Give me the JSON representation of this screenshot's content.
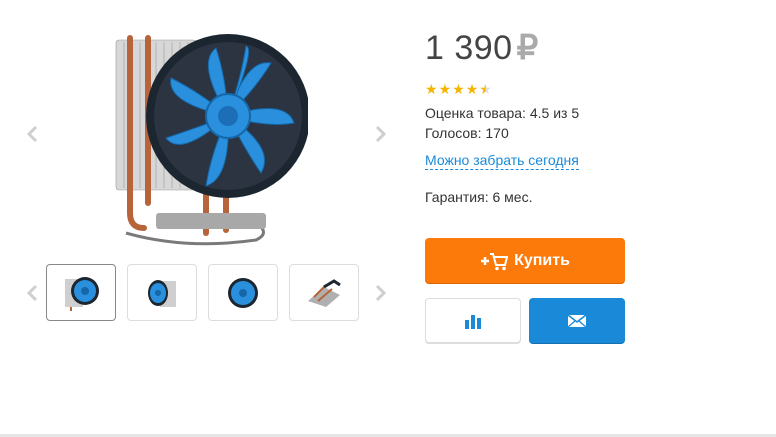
{
  "product": {
    "price": "1 390",
    "currency": "₽",
    "rating_value": 4.5,
    "rating_max": 5,
    "rating_text": "Оценка товара: 4.5 из 5",
    "votes_text": "Голосов: 170",
    "pickup_link": "Можно забрать сегодня",
    "warranty_text": "Гарантия: 6 мес."
  },
  "actions": {
    "buy_label": "Купить",
    "buy_icon": "add-to-cart-icon",
    "compare_icon": "bar-chart-icon",
    "mail_icon": "envelope-icon"
  },
  "gallery": {
    "thumbnails": [
      {
        "icon": "cooler-front-icon",
        "active": true
      },
      {
        "icon": "cooler-angle-icon",
        "active": false
      },
      {
        "icon": "cooler-fan-icon",
        "active": false
      },
      {
        "icon": "cooler-heatsink-icon",
        "active": false
      }
    ]
  },
  "colors": {
    "accent_orange": "#fb7a0a",
    "accent_blue": "#1a8ad8",
    "star": "#f5b400",
    "fan_blue": "#2a8fdc"
  }
}
